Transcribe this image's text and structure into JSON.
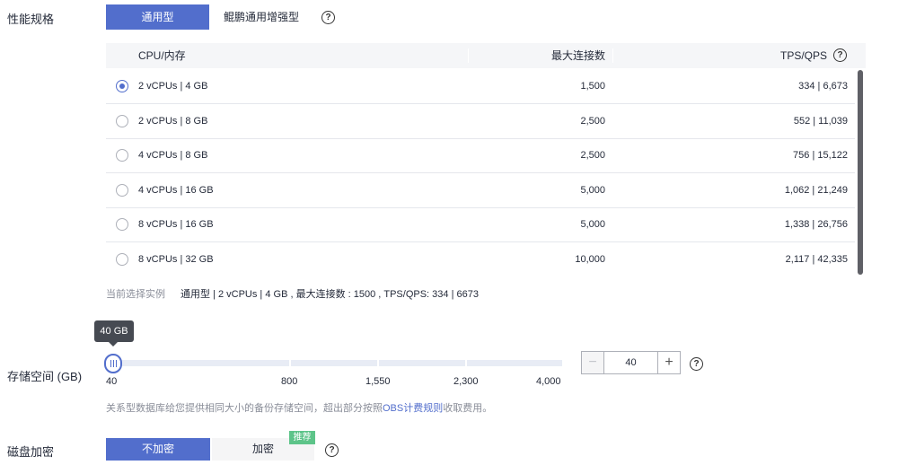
{
  "spec": {
    "label": "性能规格",
    "tabs": [
      "通用型",
      "鲲鹏通用增强型"
    ],
    "active_tab": "通用型"
  },
  "help_glyph": "?",
  "table": {
    "headers": {
      "cpu": "CPU/内存",
      "conn": "最大连接数",
      "tps": "TPS/QPS"
    },
    "rows": [
      {
        "cpu": "2 vCPUs | 4 GB",
        "conn": "1,500",
        "tps": "334 | 6,673",
        "selected": true
      },
      {
        "cpu": "2 vCPUs | 8 GB",
        "conn": "2,500",
        "tps": "552 | 11,039",
        "selected": false
      },
      {
        "cpu": "4 vCPUs | 8 GB",
        "conn": "2,500",
        "tps": "756 | 15,122",
        "selected": false
      },
      {
        "cpu": "4 vCPUs | 16 GB",
        "conn": "5,000",
        "tps": "1,062 | 21,249",
        "selected": false
      },
      {
        "cpu": "8 vCPUs | 16 GB",
        "conn": "5,000",
        "tps": "1,338 | 26,756",
        "selected": false
      },
      {
        "cpu": "8 vCPUs | 32 GB",
        "conn": "10,000",
        "tps": "2,117 | 42,335",
        "selected": false
      }
    ]
  },
  "summary": {
    "label": "当前选择实例",
    "value": "通用型 | 2 vCPUs | 4 GB , 最大连接数 : 1500 , TPS/QPS: 334 | 6673"
  },
  "storage": {
    "label": "存储空间 (GB)",
    "tooltip": "40 GB",
    "ticks": [
      "40",
      "800",
      "1,550",
      "2,300",
      "4,000"
    ],
    "value": 40,
    "input_value": "40",
    "minus": "−",
    "plus": "+",
    "hint_prefix": "关系型数据库给您提供相同大小的备份存储空间，超出部分按照",
    "hint_link": "OBS计费规则",
    "hint_suffix": "收取费用。"
  },
  "encryption": {
    "label": "磁盘加密",
    "options": [
      "不加密",
      "加密"
    ],
    "active": "不加密",
    "badge": "推荐"
  },
  "colors": {
    "accent": "#526ecc",
    "badge": "#5dc489",
    "tooltip_bg": "#464a52"
  }
}
